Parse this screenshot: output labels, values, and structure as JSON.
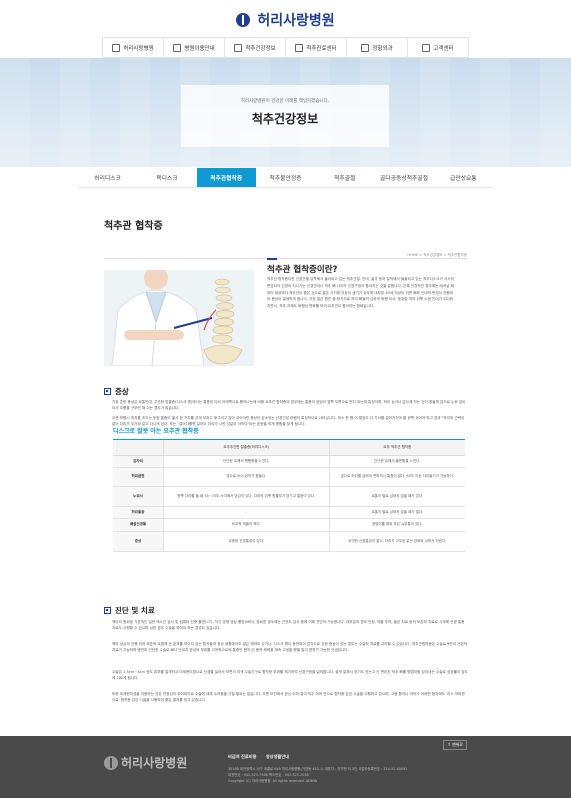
{
  "header": {
    "logo_text": "허리사랑병원"
  },
  "gnb": [
    {
      "label": "허리사랑병원",
      "icon": "hospital-icon"
    },
    {
      "label": "병원이용안내",
      "icon": "document-icon"
    },
    {
      "label": "척추건강정보",
      "icon": "book-icon"
    },
    {
      "label": "척추진료센터",
      "icon": "stethoscope-icon"
    },
    {
      "label": "정형외과",
      "icon": "bone-icon"
    },
    {
      "label": "고객센터",
      "icon": "support-icon"
    }
  ],
  "hero": {
    "subtitle": "허리사랑병원이 건강한 미래를 책임지겠습니다.",
    "title": "척추건강정보"
  },
  "subnav": [
    "허리디스크",
    "목디스크",
    "척추관협착증",
    "척추불안정증",
    "척추골절",
    "골다공증성척추골절",
    "급만성요통"
  ],
  "subnav_active": 2,
  "page": {
    "title": "척추관 협착증",
    "breadcrumb": "HOME > 척추건강정보 > 척추관협착증"
  },
  "intro": {
    "title": "척추관 협착증이란?",
    "text": "척추관 협착증이란 신경관을 뒤쪽에서 둘러싸고 있는 척추관절, 인대, 골극 등과 탈척에서 돌출되고 있는 척추디스크가 서서히 변성되어 신경이 지나가는 신경관이나 척추 뼈 사이의 신경구멍이 좁아지는 것을 말합니다. 간혹 선천적인 경우에는 태어날 때부터 정상보다 척추관이 좁은 것으로 젊은 시기에 이상이 생기기 쉬우며 대부분 40세 이상이 되면 뼈와 인대의 변성이 진행되어 증상이 발생하게 됩니다. 가장 많은 원인 중 한가지로 허리 뼈들의 심하게 퇴행 되고, 등처럼 허리 뒤쪽 노란 인대가 두터워지면서, 척추 자체도 퇴행성 변화를 보여 요추관이 좁아지는 형태입니다."
  },
  "symptoms": {
    "heading": "증상",
    "p1": "가장 흔한 증상은 요통인데, 주관한 방울증(디스크 병)에서는 통증이 다리 아래쪽으로 뻗어나는데 비해 요추관 협착증의 경우에는 통증이 엉덩이 옆쪽 뒤쪽으로 번지 되는게 특징이며, 허리 능가나 앉으게 자는 것이 힘들며 앉으로 누워 앉아이서 무릎을 구부린 채 쉬는 경우가 많습니다.",
    "p2": "오랜 보행시 하지를 조이는 듯한 통증이 옮서 한 가지를 걷게 보하고 쭈그리고 앉아 쉬어야만 증상이 감소되는 신경인성 파행이 특징적으로 나타납니다. 허스 한 행 이 멀었도 더 가서를 걸어가거야 할 한쪽 쉬어야 하고 경과 \"하지의 근력이 없어 다리가 무거워 같고 다니게 된다. 또는 \"걸어다를면 길어도 다리가 시린 것같이 아프다\"라는 표현을 하게 병원을 찾게 됩니다."
  },
  "comparison": {
    "title": "디스크로 잘못 아는 요추관 협착증",
    "headers": [
      "",
      "요추추간판 탈출증(허리디스크)",
      "요추 척추관 협착증"
    ],
    "rows": [
      [
        "감자리",
        "단단한 유해서 뻣뻣함을 느낀다.",
        "단단한 유해서 불편함을 느낀다."
      ],
      [
        "허리굽힘",
        "앉으로 숙이 굽히기 힘들다.",
        "앉으로 허리를 굽혀야 편하거나 통증이 없다. 60도 이상 다리들기가 가능하다."
      ],
      [
        "누워서",
        "한쪽 다리를 들 때 35~70도 사이에서 당김이 있다. 다리의 뒤쪽 힘줄부가 당기고 통증이 있다.",
        "요통이 별로 심하지 않을 때가 있다."
      ],
      [
        "허리통증",
        "-",
        "요통이 별로 심하지 않을 때가 많다."
      ],
      [
        "배설신경통",
        "비교적 게을리 적다.",
        "엉덩이를 제외 추은 뉴부통이 있다."
      ],
      [
        "증상",
        "무증한 신경통성이 있다.",
        "무엇한 신경통성이 없고, 다리가 고무된 없는 감퇴와 서파서 저린다."
      ]
    ]
  },
  "treatment": {
    "heading": "진단 및 치료",
    "p1": "엑아리 원위및 기본적인 일반 엑스선 검사 및 컴퓨터 단층 촬영(CT), 자기 공명 영상 촬영(MRI), 중요한 경우에는 근전도 검사 등에 이해 진단이 가능합니다. 대부분의 경우 안정, 약물 투여, 올곧 치료 등의 보존적 치료로 시작해 신경 통증 치료도 시행할 수 있으며 심한 경우 수술을 하여야 하는 경우도 있습니다.",
    "p2": "엑아 상급의 진행 되어 보존적 요법에 곤 효과를 보이지 않는 환자들과 정상 생활에서도 많은 제약이 있거나, 디스크 병이 동반되어 감각으로 심한 증상이 있는 경우는 수술적 치료를 고려할 수 있습니다. 척추관협착증은 수술로서만이 근본적 치료가 가능하며 병인의 간단한 수술로 빠나 단내치 완성되 부위를 고쳐줘으로써 통증인 원칙 인 증력 제력을 재속 고생을 했을 많이 편한가 가능한 것생입니다.",
    "p3": "수술은 1.5cm~3cm 정도 피부를 절개하고 미세현미경으로 신경을 눌러서 보면서 이색 수술기구로 협착한 부위를 제거하여 신경구멍을 넓혀줍니다. 쉽게 말해서 공기도 짓는고 신 면이진 척추 뼈를 방법처럼 감아내는 수술로 성공률이 앞도에 이르게 됩니다.",
    "p4": "또한 미세현미경을 이용하는 것은 안정성이 뛰어하므로 수술에 대해 두려움을 가질 필요는 없습니다. 오면 보전에서 한신 이하 절여 적주 아하 반으로 협착증 감압 시술을 시행하고 있으며, 고령 환자나 아하가 어려운 환자에도 '리스 어떠한으로' 협착증 감압 시술을 시행하여 좋은 결과를 얻고 있습니다."
  },
  "footer": {
    "top_label": "↑ 맨위로",
    "logo_text": "허리사랑병원",
    "links": [
      "비급여 진료비용",
      "영상생활안내"
    ],
    "info1": "30188 대전광역시 서구 계룡로 649 허리사랑병원(가장동 453-1)   대표자 : 권기현 외 3인   사업자등록번호 : 314-92-40092",
    "info2": "대표번호 : 042-525-7588   팩스번호 : 042-525-2038",
    "copyright": "Copyright (C) 허리사랑병원. All rights reserved.   ADMIN"
  },
  "colors": {
    "brand": "#1f3f8f",
    "accent": "#0f9ad3",
    "footer": "#4a4a4a"
  }
}
